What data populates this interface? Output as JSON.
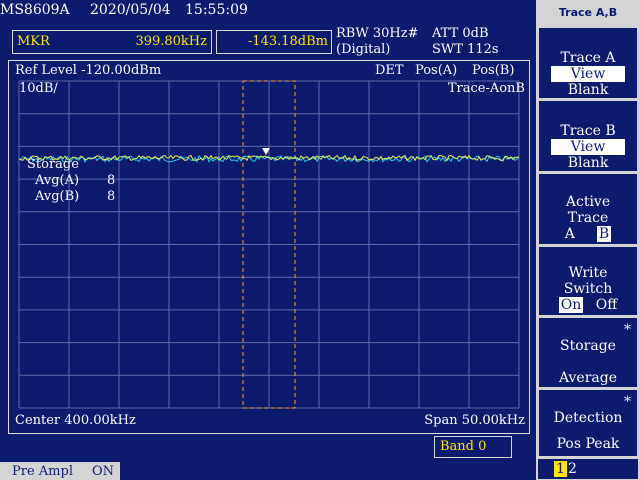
{
  "topbar": {
    "model": "MS8609A",
    "date": "2020/05/04",
    "time": "15:55:09"
  },
  "marker": {
    "label": "MKR",
    "freq": "399.80kHz",
    "level": "-143.18dBm"
  },
  "settings": {
    "rbw": "RBW 30Hz#",
    "rbw_mode": "(Digital)",
    "att": "ATT 0dB",
    "swt": "SWT 112s"
  },
  "graph": {
    "ref_level": "Ref Level -120.00dBm",
    "scale": "10dB/",
    "det": "DET",
    "det_a": "Pos(A)",
    "det_b": "Pos(B)",
    "trace_mode": "Trace-AonB",
    "storage_label": "Storage",
    "avg_a_label": "Avg(A)",
    "avg_a_value": "8",
    "avg_b_label": "Avg(B)",
    "avg_b_value": "8",
    "center": "Center 400.00kHz",
    "span": "Span 50.00kHz"
  },
  "band": "Band 0",
  "pre_ampl": {
    "label": "Pre Ampl",
    "state": "ON"
  },
  "softkeys": {
    "title": "Trace A,B",
    "trace_a": {
      "l1": "Trace A",
      "l2": "View",
      "l3": "Blank"
    },
    "trace_b": {
      "l1": "Trace B",
      "l2": "View",
      "l3": "Blank"
    },
    "active": {
      "l1": "Active",
      "l2": "Trace",
      "a": "A",
      "b": "B"
    },
    "write": {
      "l1": "Write",
      "l2": "Switch",
      "on": "On",
      "off": "Off"
    },
    "storage": {
      "star": "*",
      "l1": "Storage",
      "l2": "Average"
    },
    "detection": {
      "star": "*",
      "l1": "Detection",
      "l2": "Pos Peak"
    },
    "pages": {
      "p1": "1",
      "p2": "2"
    }
  },
  "colors": {
    "screen_bg": "#0c1b6e",
    "grid": "#5a6aa8",
    "trace_a": "#e8f050",
    "trace_b": "#2ec7e6",
    "band_marker": "#ff9a1a"
  }
}
